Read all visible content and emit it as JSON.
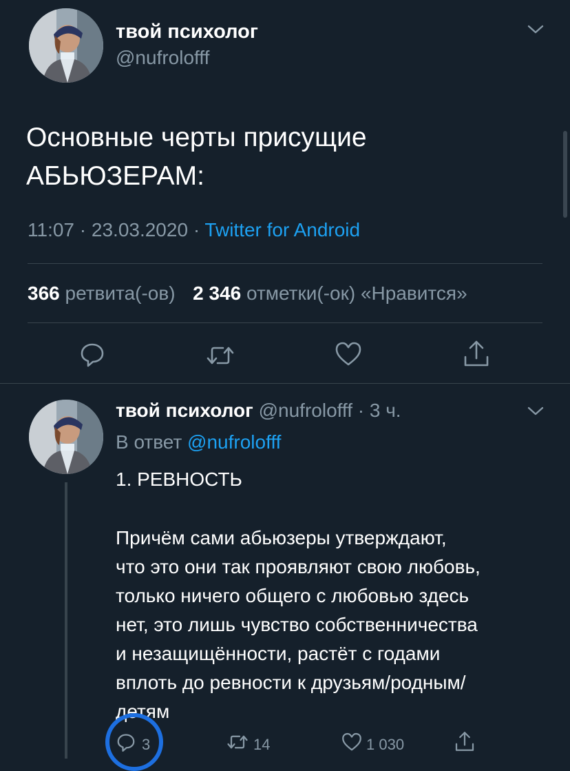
{
  "main_tweet": {
    "display_name": "твой психолог",
    "handle": "@nufrolofff",
    "text_line1": "Основные черты присущие",
    "text_line2": "АБЬЮЗЕРАМ:",
    "time": "11:07",
    "date": "23.03.2020",
    "separator": "·",
    "client": "Twitter for Android",
    "retweets_count": "366",
    "retweets_label": "ретвита(-ов)",
    "likes_count": "2 346",
    "likes_label": "отметки(-ок) «Нравится»"
  },
  "reply_tweet": {
    "display_name": "твой психолог",
    "handle_time": "@nufrolofff · 3 ч.",
    "reply_prefix": "В ответ",
    "reply_to": "@nufrolofff",
    "line_title": "1. РЕВНОСТЬ",
    "body_lines": [
      "Причём сами абьюзеры утверждают,",
      "что это они так проявляют свою любовь,",
      "только ничего общего с любовью здесь",
      "нет, это лишь чувство собственничества",
      "и незащищённости, растёт с годами",
      "вплоть до ревности к друзьям/родным/",
      "детям"
    ],
    "reply_count": "3",
    "retweet_count": "14",
    "like_count": "1 030"
  },
  "colors": {
    "background": "#15202b",
    "accent": "#1da1f2",
    "muted": "#8899a6",
    "highlight_circle": "#1d6fe0"
  },
  "icons": [
    "chevron-down-icon",
    "reply-icon",
    "retweet-icon",
    "heart-icon",
    "share-icon"
  ]
}
